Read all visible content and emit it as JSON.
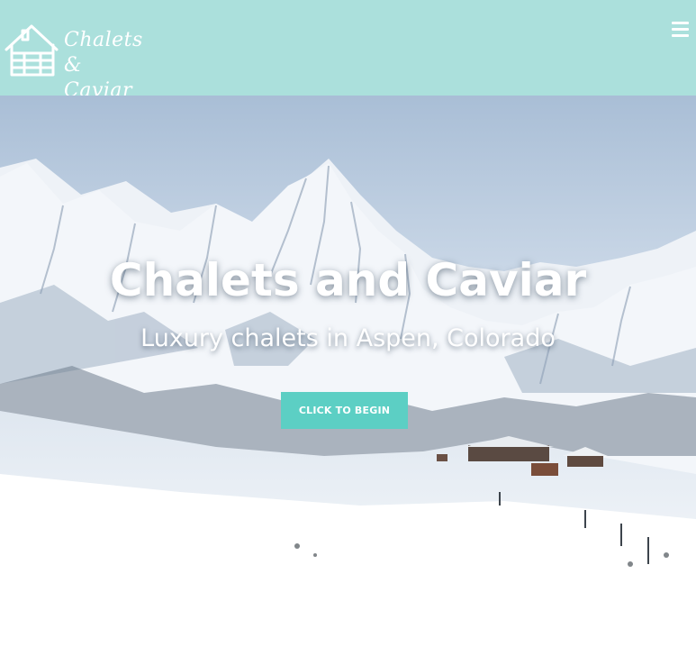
{
  "header": {
    "brand_line1": "Chalets",
    "brand_line2": "& Caviar",
    "logo_icon": "chalet-house-icon",
    "menu_icon": "hamburger-menu-icon",
    "background_color": "#abe0dc"
  },
  "hero": {
    "title": "Chalets and Caviar",
    "subtitle": "Luxury chalets in Aspen, Colorado",
    "cta_label": "Click to Begin",
    "cta_color": "#5ccfc4"
  }
}
